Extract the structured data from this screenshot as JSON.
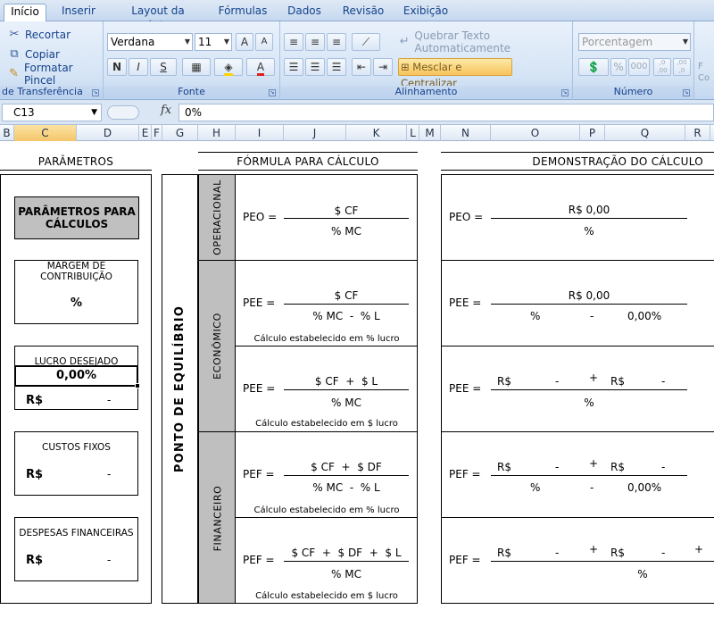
{
  "ribbon": {
    "tabs": [
      "Início",
      "Inserir",
      "Layout da Página",
      "Fórmulas",
      "Dados",
      "Revisão",
      "Exibição"
    ],
    "clipboard": {
      "cut": "Recortar",
      "copy": "Copiar",
      "format_painter": "Formatar Pincel",
      "group_label": "de Transferência"
    },
    "font": {
      "name": "Verdana",
      "size": "11",
      "bold": "N",
      "italic": "I",
      "underline": "S",
      "group_label": "Fonte"
    },
    "alignment": {
      "wrap_text": "Quebrar Texto Automaticamente",
      "merge_center": "Mesclar e Centralizar",
      "group_label": "Alinhamento"
    },
    "number": {
      "format": "Porcentagem",
      "percent": "%",
      "thousands": "000",
      "inc_decimal": ",0 ,00",
      "dec_decimal": ",00 ,0",
      "group_label": "Número"
    },
    "cut_off_label": "F\nCo"
  },
  "formula_bar": {
    "name_box": "C13",
    "fx": "fx",
    "formula": "0%"
  },
  "columns": [
    "B",
    "C",
    "D",
    "E",
    "F",
    "G",
    "H",
    "I",
    "J",
    "K",
    "L",
    "M",
    "N",
    "O",
    "P",
    "Q",
    "R"
  ],
  "selected_column": "C",
  "sheet": {
    "parametros": {
      "title": "PARÂMETROS",
      "header": "PARÂMETROS PARA CÁLCULOS",
      "margem": {
        "label": "MARGEM DE CONTRIBUIÇÃO",
        "value": "%"
      },
      "lucro": {
        "label": "LUCRO DESEJADO",
        "value_pct": "0,00%",
        "rs": "R$",
        "value": "-"
      },
      "custos_fixos": {
        "label": "CUSTOS FIXOS",
        "rs": "R$",
        "value": "-"
      },
      "despesas": {
        "label": "DESPESAS FINANCEIRAS",
        "rs": "R$",
        "value": "-"
      }
    },
    "formula": {
      "title": "FÓRMULA PARA CÁLCULO",
      "main_label": "PONTO DE EQUILÍBRIO",
      "operacional": "OPERACIONAL",
      "economico": "ECONÔMICO",
      "financeiro": "FINANCEIRO",
      "peo": {
        "lhs": "PEO =",
        "num": "$ CF",
        "den": "% MC"
      },
      "pee1": {
        "lhs": "PEE =",
        "num": "$ CF",
        "den": "% MC  -  % L",
        "note": "Cálculo estabelecido em % lucro"
      },
      "pee2": {
        "lhs": "PEE =",
        "num": "$ CF  +  $ L",
        "den": "% MC",
        "note": "Cálculo estabelecido em $ lucro"
      },
      "pef1": {
        "lhs": "PEF =",
        "num": "$ CF  +  $ DF",
        "den": "% MC  -  % L",
        "note": "Cálculo estabelecido em % lucro"
      },
      "pef2": {
        "lhs": "PEF =",
        "num": "$ CF  +  $ DF  +  $ L",
        "den": "% MC",
        "note": "Cálculo estabelecido em $ lucro"
      }
    },
    "demo": {
      "title": "DEMONSTRAÇÃO DO CÁLCULO",
      "peo": {
        "lhs": "PEO =",
        "num": "R$ 0,00",
        "den": "%"
      },
      "pee1": {
        "lhs": "PEE =",
        "num": "R$ 0,00",
        "den_a": "%",
        "den_op": "-",
        "den_b": "0,00%"
      },
      "pee2": {
        "lhs": "PEE =",
        "rs1": "R$",
        "v1": "-",
        "plus": "+",
        "rs2": "R$",
        "v2": "-",
        "den": "%"
      },
      "pef1": {
        "lhs": "PEF =",
        "rs1": "R$",
        "v1": "-",
        "plus": "+",
        "rs2": "R$",
        "v2": "-",
        "den_a": "%",
        "den_op": "-",
        "den_b": "0,00%"
      },
      "pef2": {
        "lhs": "PEF =",
        "rs1": "R$",
        "v1": "-",
        "plus": "+",
        "rs2": "R$",
        "v2": "-",
        "plus2": "+",
        "den": "%"
      }
    }
  }
}
